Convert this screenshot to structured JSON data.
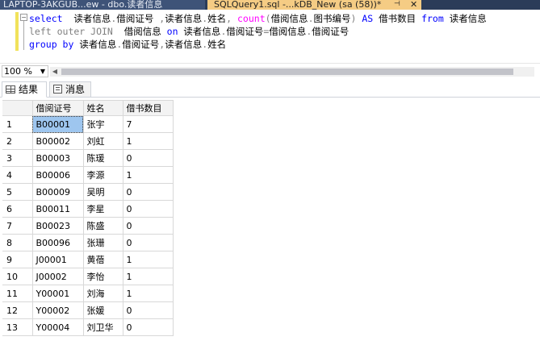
{
  "tabs": {
    "inactive_label": "LAPTOP-3AKGUB...ew - dbo.读者信息",
    "active_label": "SQLQuery1.sql -...kDB_New (sa (58))*",
    "pin_glyph": "⊣",
    "close_glyph": "✕"
  },
  "editor": {
    "line1": {
      "kw1": "select",
      "t1": "  读者信息",
      "p1": ".",
      "t2": "借阅证号",
      "p2": " ,",
      "t3": "读者信息",
      "p3": ".",
      "t4": "姓名",
      "p4": ", ",
      "fn": "count",
      "p5": "(",
      "t5": "借阅信息",
      "p6": ".",
      "t6": "图书编号",
      "p7": ")",
      "kw2": " AS ",
      "t7": "借书数目 ",
      "kw3": "from",
      "t8": " 读者信息"
    },
    "line2": {
      "g1": "left outer JOIN",
      "t1": "  借阅信息 ",
      "kw1": "on",
      "t2": " 读者信息",
      "p1": ".",
      "t3": "借阅证号",
      "p2": "=",
      "t4": "借阅信息",
      "p3": ".",
      "t5": "借阅证号"
    },
    "line3": {
      "kw1": "group by",
      "t1": " 读者信息",
      "p1": ".",
      "t2": "借阅证号",
      "p2": ",",
      "t3": "读者信息",
      "p3": ".",
      "t4": "姓名"
    }
  },
  "zoom": {
    "value": "100 %"
  },
  "result_tabs": {
    "results": "结果",
    "messages": "消息"
  },
  "grid": {
    "columns": [
      "借阅证号",
      "姓名",
      "借书数目"
    ],
    "rows": [
      {
        "n": "1",
        "id": "B00001",
        "name": "张宇",
        "count": "7"
      },
      {
        "n": "2",
        "id": "B00002",
        "name": "刘虹",
        "count": "1"
      },
      {
        "n": "3",
        "id": "B00003",
        "name": "陈瑗",
        "count": "0"
      },
      {
        "n": "4",
        "id": "B00006",
        "name": "李源",
        "count": "1"
      },
      {
        "n": "5",
        "id": "B00009",
        "name": "吴明",
        "count": "0"
      },
      {
        "n": "6",
        "id": "B00011",
        "name": "李星",
        "count": "0"
      },
      {
        "n": "7",
        "id": "B00023",
        "name": "陈盛",
        "count": "0"
      },
      {
        "n": "8",
        "id": "B00096",
        "name": "张珊",
        "count": "0"
      },
      {
        "n": "9",
        "id": "J00001",
        "name": "黄蓓",
        "count": "1"
      },
      {
        "n": "10",
        "id": "J00002",
        "name": "李怡",
        "count": "1"
      },
      {
        "n": "11",
        "id": "Y00001",
        "name": "刘海",
        "count": "1"
      },
      {
        "n": "12",
        "id": "Y00002",
        "name": "张媛",
        "count": "0"
      },
      {
        "n": "13",
        "id": "Y00004",
        "name": "刘卫华",
        "count": "0"
      }
    ]
  }
}
